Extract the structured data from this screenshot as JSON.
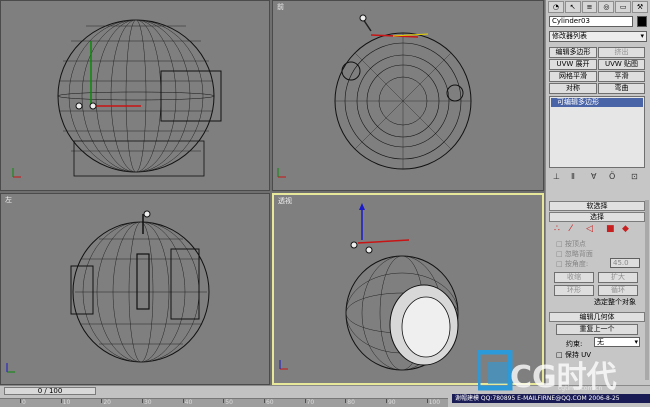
{
  "viewports": [
    {
      "label": "",
      "kind": "front"
    },
    {
      "label": "前",
      "kind": "top"
    },
    {
      "label": "左",
      "kind": "left"
    },
    {
      "label": "透视",
      "kind": "persp"
    }
  ],
  "panel": {
    "tab_icons": [
      "sphere-icon",
      "cursor-icon",
      "hierarchy-icon",
      "motion-icon",
      "display-icon",
      "hammer-icon"
    ],
    "object_name": "Cylinder03",
    "modifier_list": "修改器列表",
    "buttons": [
      "编辑多边形",
      "挤出",
      "UVW 展开",
      "UVW 贴图",
      "网格平滑",
      "平滑",
      "对称",
      "弯曲"
    ],
    "stack_item": "可编辑多边形",
    "rollout_soft": "软选择",
    "rollout_select": "选择",
    "opt_by_vertex": "按顶点",
    "opt_ignore_back": "忽略背面",
    "opt_by_angle": "按角度:",
    "angle_value": "45.0",
    "btn_shrink": "收缩",
    "btn_grow": "扩大",
    "btn_ring": "环形",
    "btn_loop": "循环",
    "sel_status": "选定整个对象",
    "rollout_edit": "编辑几何体",
    "btn_repeat": "重复上一个",
    "constraint_label": "约束:",
    "constraint_value": "无",
    "opt_preserve_uv": "保持 UV"
  },
  "status": {
    "timeline": "0 / 100",
    "info": "谢帽建模 QQ:780895 E-MAILFIRNE@QQ.COM 2006-8-25",
    "logo_text": "CG时代",
    "logo_url": "cgtime.com.cn",
    "ruler_labels": [
      "0",
      "10",
      "20",
      "30",
      "40",
      "50",
      "60",
      "70",
      "80",
      "90",
      "100"
    ]
  }
}
